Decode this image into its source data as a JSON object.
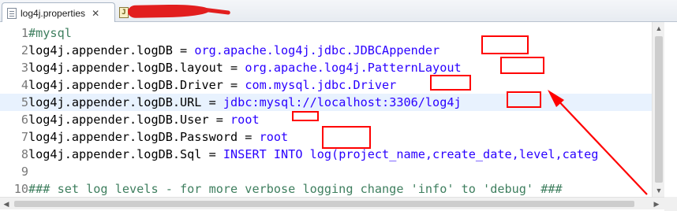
{
  "tabs": [
    {
      "label": "log4j.properties",
      "close_label": "✕",
      "active": true
    },
    {
      "label": "",
      "redacted": true,
      "active": false
    }
  ],
  "editor": {
    "lines": [
      {
        "num": "1",
        "segments": [
          {
            "text": "#mysql",
            "kind": "cmt"
          }
        ]
      },
      {
        "num": "2",
        "segments": [
          {
            "text": "log4j.appender.logDB = ",
            "kind": "key"
          },
          {
            "text": "org.apache.log4j.jdbc.JDBCAppender",
            "kind": "val"
          }
        ]
      },
      {
        "num": "3",
        "segments": [
          {
            "text": "log4j.appender.logDB.layout = ",
            "kind": "key"
          },
          {
            "text": "org.apache.log4j.PatternLayout",
            "kind": "val"
          }
        ]
      },
      {
        "num": "4",
        "segments": [
          {
            "text": "log4j.appender.logDB.Driver = ",
            "kind": "key"
          },
          {
            "text": "com.mysql.jdbc.Driver",
            "kind": "val"
          }
        ]
      },
      {
        "num": "5",
        "current": true,
        "segments": [
          {
            "text": "log4j.appender.logDB.URL = ",
            "kind": "key"
          },
          {
            "text": "jdbc:mysql://localhost:3306/log4j",
            "kind": "val"
          }
        ]
      },
      {
        "num": "6",
        "segments": [
          {
            "text": "log4j.appender.logDB.User = ",
            "kind": "key"
          },
          {
            "text": "root",
            "kind": "val"
          }
        ]
      },
      {
        "num": "7",
        "segments": [
          {
            "text": "log4j.appender.logDB.Password = ",
            "kind": "key"
          },
          {
            "text": "root",
            "kind": "val"
          }
        ]
      },
      {
        "num": "8",
        "segments": [
          {
            "text": "log4j.appender.logDB.Sql = ",
            "kind": "key"
          },
          {
            "text": "INSERT INTO log(project_name,create_date,level,categ",
            "kind": "val"
          }
        ]
      },
      {
        "num": "9",
        "segments": []
      },
      {
        "num": "10",
        "segments": [
          {
            "text": "### set log levels - for more verbose logging change 'info' to 'debug' ###",
            "kind": "cmt"
          }
        ]
      }
    ]
  },
  "scrollbars": {
    "up_arrow": "▲",
    "down_arrow": "▼",
    "left_arrow": "◀",
    "right_arrow": "▶"
  },
  "colors": {
    "value": "#2a00ff",
    "comment": "#3f7f5f",
    "annotation": "#ff0000",
    "current_line": "#e8f2fe"
  }
}
